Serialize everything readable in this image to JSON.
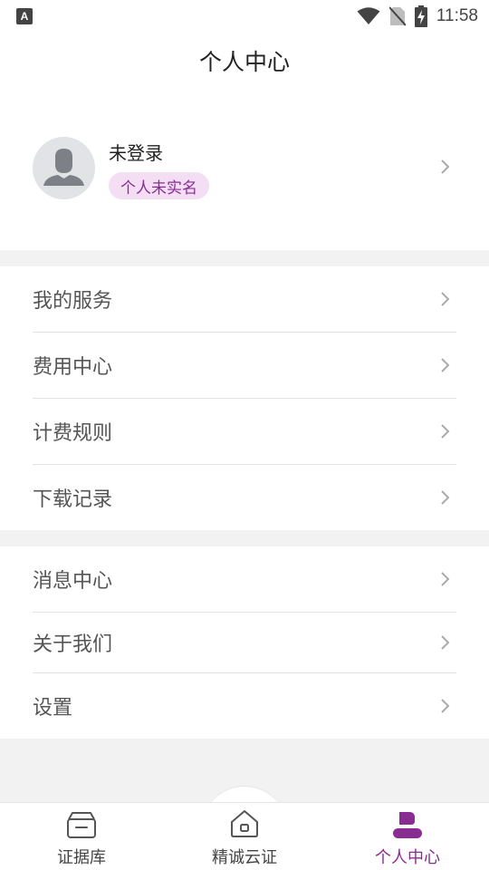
{
  "status_bar": {
    "time": "11:58",
    "app_icon_letter": "A",
    "icons": [
      "wifi-icon",
      "no-sim-icon",
      "battery-charging-icon"
    ]
  },
  "header": {
    "title": "个人中心"
  },
  "profile": {
    "username": "未登录",
    "badge": "个人未实名",
    "avatar_icon": "person-silhouette-icon"
  },
  "menu_groups": [
    {
      "items": [
        {
          "label": "我的服务"
        },
        {
          "label": "费用中心"
        },
        {
          "label": "计费规则"
        },
        {
          "label": "下载记录"
        }
      ]
    },
    {
      "items": [
        {
          "label": "消息中心"
        },
        {
          "label": "关于我们"
        },
        {
          "label": "设置"
        }
      ]
    }
  ],
  "tab_bar": {
    "tabs": [
      {
        "label": "证据库",
        "icon": "archive-box-icon",
        "active": false
      },
      {
        "label": "精诚云证",
        "icon": "home-icon",
        "active": false
      },
      {
        "label": "个人中心",
        "icon": "user-icon",
        "active": true
      }
    ]
  },
  "colors": {
    "accent": "#8a2d93",
    "badge_bg": "#f3def4",
    "background": "#f2f2f2"
  }
}
